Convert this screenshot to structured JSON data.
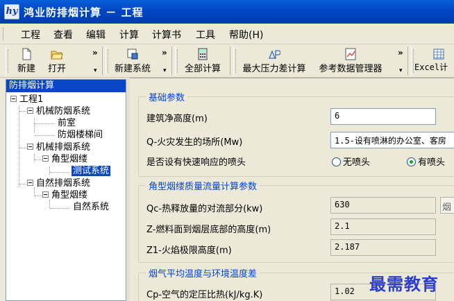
{
  "window": {
    "title": "鸿业防排烟计算 － 工程",
    "icon_text": "hy"
  },
  "menu": {
    "items": [
      "工程",
      "查看",
      "编辑",
      "计算",
      "计算书",
      "工具",
      "帮助(H)"
    ]
  },
  "toolbar": {
    "new_label": "新建",
    "open_label": "打开",
    "new_system_label": "新建系统",
    "calc_all_label": "全部计算",
    "max_pressure_label": "最大压力差计算",
    "ref_data_label": "参考数据管理器",
    "excel_label": "Excel计",
    "chevron": "»",
    "dropdown": "▾"
  },
  "tree": {
    "header": "防排烟计算",
    "nodes": {
      "project": "工程1",
      "mech_smoke_prevention": "机械防烟系统",
      "front_room": "前室",
      "smoke_stairs": "防烟楼梯间",
      "mech_smoke_exhaust": "机械排烟系统",
      "corner_plume": "角型烟缕",
      "test_system": "测试系统",
      "natural_exhaust": "自然排烟系统",
      "corner_plume_2": "角型烟缕",
      "natural_system": "自然系统"
    }
  },
  "content": {
    "basic": {
      "title": "基础参数",
      "height_label": "建筑净高度(m)",
      "height_value": "6",
      "fire_place_label": "Q-火灾发生的场所(Mw)",
      "fire_place_value": "1.5-设有喷淋的办公室、客房",
      "sprinkler_label": "是否设有快速响应的喷头",
      "no_sprinkler": "无喷头",
      "has_sprinkler": "有喷头",
      "sprinkler_selected": "有喷头"
    },
    "plume": {
      "title": "角型烟缕质量流量计算参数",
      "qc_label": "Qc-热释放量的对流部分(kw)",
      "qc_value": "630",
      "qc_side": "烟",
      "z_label": "Z-燃料面到烟层底部的高度(m)",
      "z_value": "2.1",
      "z1_label": "Z1-火焰极限高度(m)",
      "z1_value": "2.187"
    },
    "temp": {
      "title": "烟气平均温度与环境温度差",
      "cp_label": "Cp-空气的定压比热(kJ/kg.K)",
      "cp_value": "1.02"
    }
  },
  "watermark": "最需教育",
  "colors": {
    "titlebar": "#0047c3",
    "selection": "#0b46c8",
    "group_title": "#0046d5",
    "watermark": "#2d3ec8"
  }
}
